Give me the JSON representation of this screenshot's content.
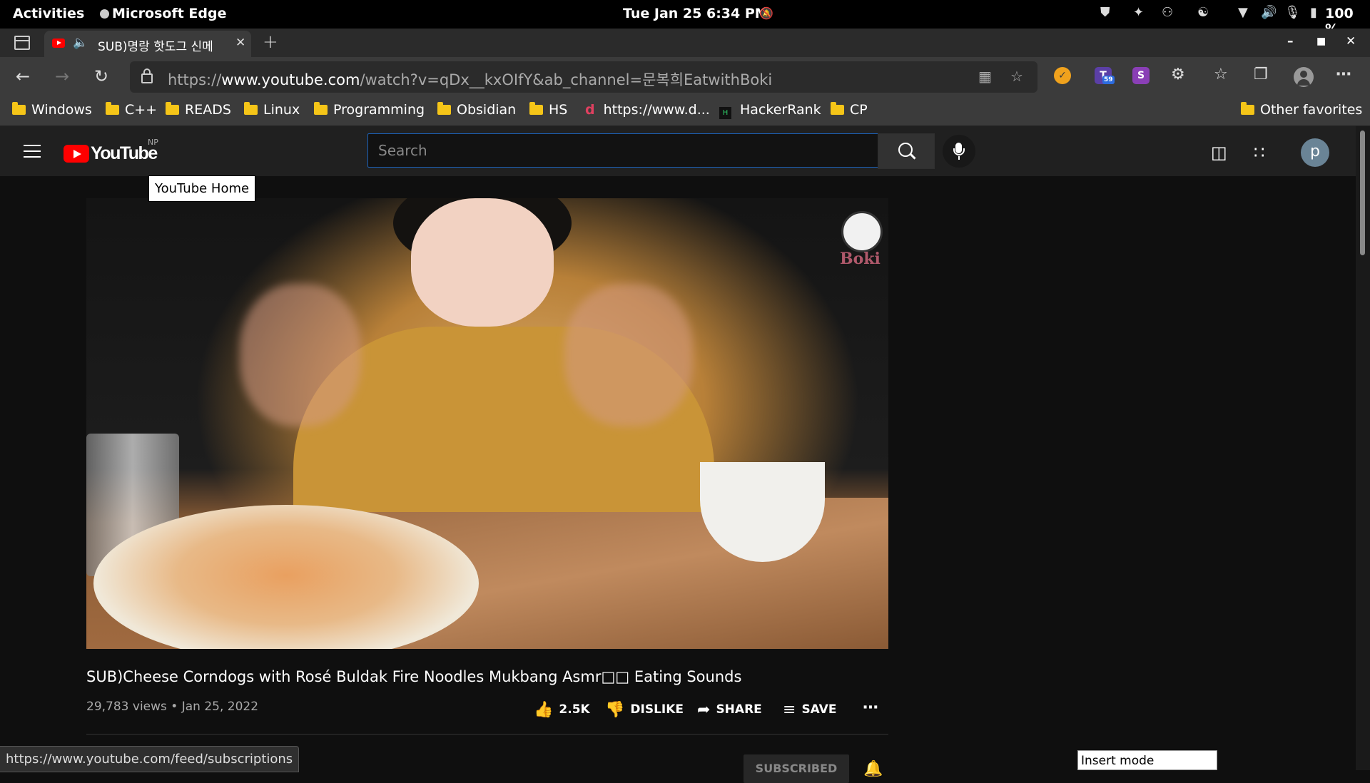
{
  "system_bar": {
    "activities": "Activities",
    "app_name": "Microsoft Edge",
    "datetime": "Tue Jan 25  6:34 PM",
    "battery": "100 %"
  },
  "browser": {
    "tab": {
      "title": "SUB)명랑 핫도그 신메"
    },
    "url": {
      "scheme": "https://",
      "host": "www.youtube.com",
      "path": "/watch?v=qDx__kxOIfY&ab_channel=문복희EatwithBoki"
    },
    "extension_badge": "59",
    "extension_s": "S",
    "bookmarks": [
      {
        "label": "Windows",
        "icon": "folder-icon"
      },
      {
        "label": "C++",
        "icon": "folder-icon"
      },
      {
        "label": "READS",
        "icon": "folder-icon"
      },
      {
        "label": "Linux",
        "icon": "folder-icon"
      },
      {
        "label": "Programming",
        "icon": "folder-icon"
      },
      {
        "label": "Obsidian",
        "icon": "folder-icon"
      },
      {
        "label": "HS",
        "icon": "folder-icon"
      },
      {
        "label": "https://www.d...",
        "icon": "site-icon"
      },
      {
        "label": "HackerRank",
        "icon": "hackerrank-icon"
      },
      {
        "label": "CP",
        "icon": "folder-icon"
      }
    ],
    "other_favorites": "Other favorites",
    "status_url": "https://www.youtube.com/feed/subscriptions",
    "insert_mode": "Insert mode"
  },
  "youtube": {
    "logo_text": "YouTube",
    "region": "NP",
    "search_placeholder": "Search",
    "avatar_letter": "p",
    "tooltip": "YouTube Home",
    "video": {
      "watermark": "Boki",
      "title": "SUB)Cheese Corndogs with Rosé Buldak Fire Noodles Mukbang Asmr□□ Eating Sounds",
      "views": "29,783 views",
      "date": "Jan 25, 2022",
      "likes": "2.5K",
      "dislike_label": "DISLIKE",
      "share_label": "SHARE",
      "save_label": "SAVE",
      "subscribe_label": "SUBSCRIBED"
    }
  },
  "colors": {
    "youtube_red": "#ff0000",
    "folder": "#f5c518",
    "search_focus": "#1c62b9"
  }
}
